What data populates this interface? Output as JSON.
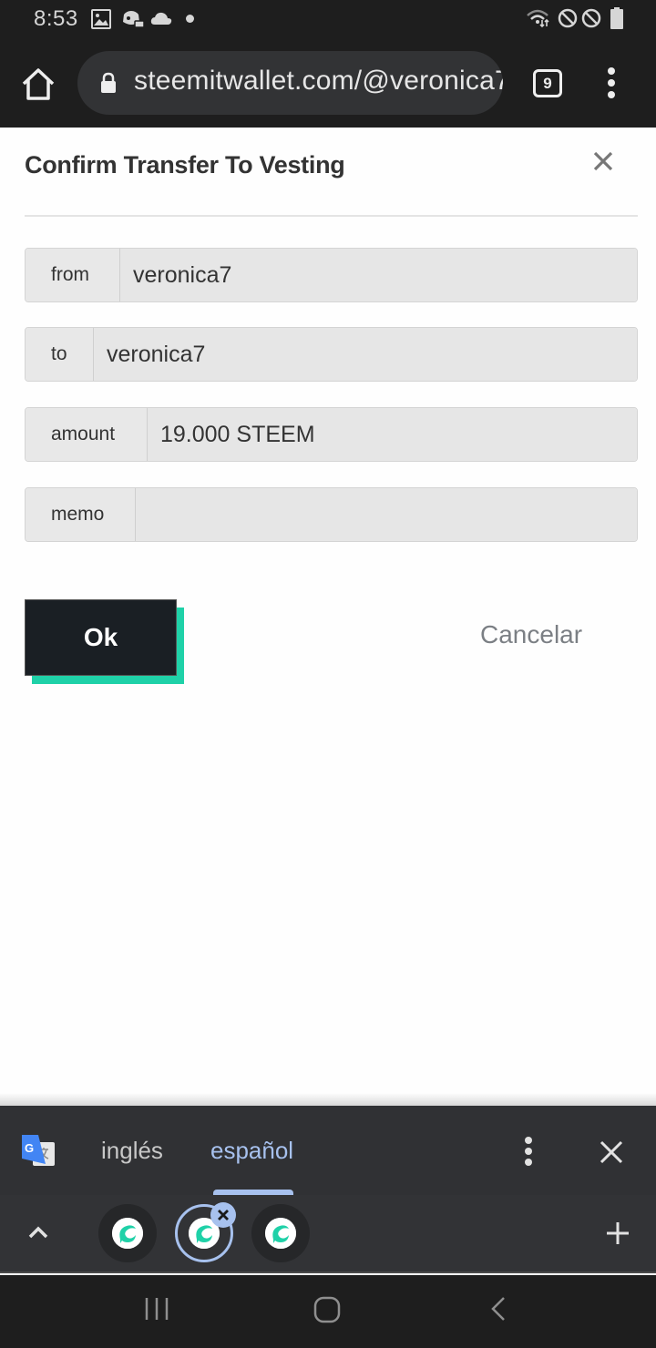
{
  "status_bar": {
    "time": "8:53",
    "left_icons": [
      "image-icon",
      "discord-icon",
      "cloud-icon",
      "dot-icon"
    ],
    "right_icons": [
      "wifi-icon",
      "do-not-disturb-icon",
      "do-not-disturb-icon",
      "battery-icon"
    ]
  },
  "browser": {
    "url": "steemitwallet.com/@veronica7",
    "tab_count": "9",
    "icons": [
      "home-icon",
      "lock-icon",
      "tab-switcher-icon",
      "more-vert-icon"
    ]
  },
  "modal": {
    "title": "Confirm Transfer To Vesting",
    "fields": [
      {
        "label": "from",
        "value": "veronica7"
      },
      {
        "label": "to",
        "value": "veronica7"
      },
      {
        "label": "amount",
        "value": "19.000 STEEM"
      },
      {
        "label": "memo",
        "value": ""
      }
    ],
    "ok_label": "Ok",
    "cancel_label": "Cancelar"
  },
  "translate_bar": {
    "languages": [
      "inglés",
      "español"
    ],
    "selected": "español"
  },
  "tab_strip": {
    "tabs": [
      {
        "favicon": "steemit-icon",
        "active": false
      },
      {
        "favicon": "steemit-icon",
        "active": true
      },
      {
        "favicon": "steemit-icon",
        "active": false
      }
    ]
  },
  "colors": {
    "accent": "#1fd1a8",
    "button_dark": "#1a1f24",
    "translate_selected": "#a7c1ee",
    "chrome_bg": "#1e1e1e"
  }
}
